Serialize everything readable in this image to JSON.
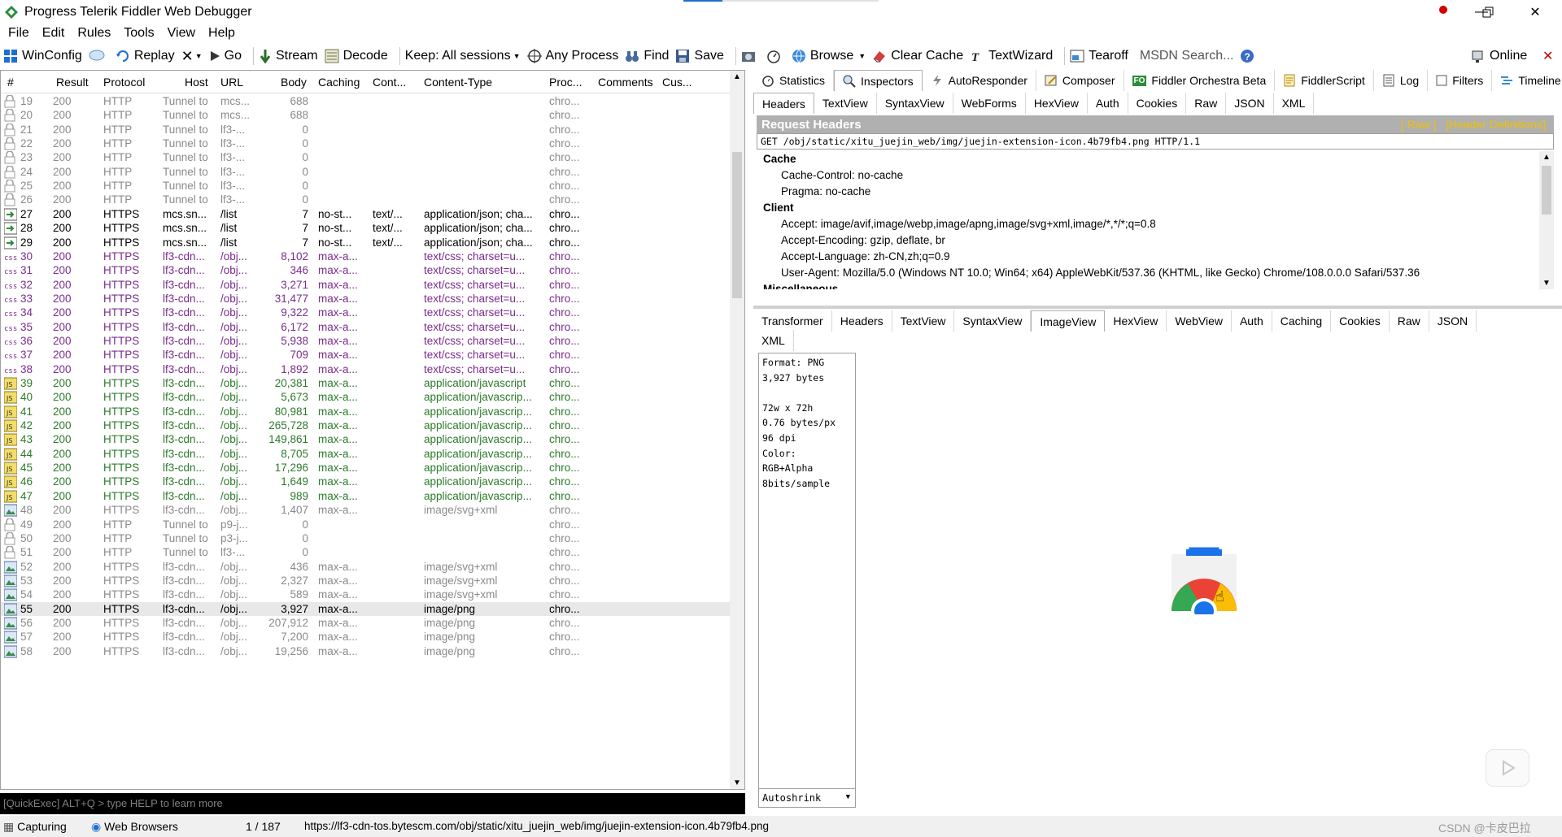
{
  "window": {
    "title": "Progress Telerik Fiddler Web Debugger"
  },
  "menu": [
    "File",
    "Edit",
    "Rules",
    "Tools",
    "View",
    "Help"
  ],
  "toolbar": {
    "winconfig": "WinConfig",
    "replay": "Replay",
    "go": "Go",
    "stream": "Stream",
    "decode": "Decode",
    "keep": "Keep: All sessions",
    "any_process": "Any Process",
    "find": "Find",
    "save": "Save",
    "browse": "Browse",
    "clear_cache": "Clear Cache",
    "textwizard": "TextWizard",
    "tearoff": "Tearoff",
    "msdn_search": "MSDN Search...",
    "online": "Online"
  },
  "columns": [
    "#",
    "Result",
    "Protocol",
    "Host",
    "URL",
    "Body",
    "Caching",
    "Cont...",
    "Content-Type",
    "Proc...",
    "Comments",
    "Cus..."
  ],
  "sessions": [
    {
      "icon": "lock",
      "color": "gray",
      "id": "19",
      "result": "200",
      "protocol": "HTTP",
      "host": "Tunnel to",
      "url": "mcs...",
      "body": "688",
      "caching": "",
      "cont": "",
      "ctype": "",
      "proc": "chro..."
    },
    {
      "icon": "lock",
      "color": "gray",
      "id": "20",
      "result": "200",
      "protocol": "HTTP",
      "host": "Tunnel to",
      "url": "mcs...",
      "body": "688",
      "caching": "",
      "cont": "",
      "ctype": "",
      "proc": "chro..."
    },
    {
      "icon": "lock",
      "color": "gray",
      "id": "21",
      "result": "200",
      "protocol": "HTTP",
      "host": "Tunnel to",
      "url": "lf3-...",
      "body": "0",
      "caching": "",
      "cont": "",
      "ctype": "",
      "proc": "chro..."
    },
    {
      "icon": "lock",
      "color": "gray",
      "id": "22",
      "result": "200",
      "protocol": "HTTP",
      "host": "Tunnel to",
      "url": "lf3-...",
      "body": "0",
      "caching": "",
      "cont": "",
      "ctype": "",
      "proc": "chro..."
    },
    {
      "icon": "lock",
      "color": "gray",
      "id": "23",
      "result": "200",
      "protocol": "HTTP",
      "host": "Tunnel to",
      "url": "lf3-...",
      "body": "0",
      "caching": "",
      "cont": "",
      "ctype": "",
      "proc": "chro..."
    },
    {
      "icon": "lock",
      "color": "gray",
      "id": "24",
      "result": "200",
      "protocol": "HTTP",
      "host": "Tunnel to",
      "url": "lf3-...",
      "body": "0",
      "caching": "",
      "cont": "",
      "ctype": "",
      "proc": "chro..."
    },
    {
      "icon": "lock",
      "color": "gray",
      "id": "25",
      "result": "200",
      "protocol": "HTTP",
      "host": "Tunnel to",
      "url": "lf3-...",
      "body": "0",
      "caching": "",
      "cont": "",
      "ctype": "",
      "proc": "chro..."
    },
    {
      "icon": "lock",
      "color": "gray",
      "id": "26",
      "result": "200",
      "protocol": "HTTP",
      "host": "Tunnel to",
      "url": "lf3-...",
      "body": "0",
      "caching": "",
      "cont": "",
      "ctype": "",
      "proc": "chro..."
    },
    {
      "icon": "json",
      "color": "black",
      "id": "27",
      "result": "200",
      "protocol": "HTTPS",
      "host": "mcs.sn...",
      "url": "/list",
      "body": "7",
      "caching": "no-st...",
      "cont": "text/...",
      "ctype": "application/json; cha...",
      "proc": "chro..."
    },
    {
      "icon": "json",
      "color": "black",
      "id": "28",
      "result": "200",
      "protocol": "HTTPS",
      "host": "mcs.sn...",
      "url": "/list",
      "body": "7",
      "caching": "no-st...",
      "cont": "text/...",
      "ctype": "application/json; cha...",
      "proc": "chro..."
    },
    {
      "icon": "json",
      "color": "black",
      "id": "29",
      "result": "200",
      "protocol": "HTTPS",
      "host": "mcs.sn...",
      "url": "/list",
      "body": "7",
      "caching": "no-st...",
      "cont": "text/...",
      "ctype": "application/json; cha...",
      "proc": "chro..."
    },
    {
      "icon": "css",
      "color": "purple",
      "id": "30",
      "result": "200",
      "protocol": "HTTPS",
      "host": "lf3-cdn...",
      "url": "/obj...",
      "body": "8,102",
      "caching": "max-a...",
      "cont": "",
      "ctype": "text/css; charset=u...",
      "proc": "chro..."
    },
    {
      "icon": "css",
      "color": "purple",
      "id": "31",
      "result": "200",
      "protocol": "HTTPS",
      "host": "lf3-cdn...",
      "url": "/obj...",
      "body": "346",
      "caching": "max-a...",
      "cont": "",
      "ctype": "text/css; charset=u...",
      "proc": "chro..."
    },
    {
      "icon": "css",
      "color": "purple",
      "id": "32",
      "result": "200",
      "protocol": "HTTPS",
      "host": "lf3-cdn...",
      "url": "/obj...",
      "body": "3,271",
      "caching": "max-a...",
      "cont": "",
      "ctype": "text/css; charset=u...",
      "proc": "chro..."
    },
    {
      "icon": "css",
      "color": "purple",
      "id": "33",
      "result": "200",
      "protocol": "HTTPS",
      "host": "lf3-cdn...",
      "url": "/obj...",
      "body": "31,477",
      "caching": "max-a...",
      "cont": "",
      "ctype": "text/css; charset=u...",
      "proc": "chro..."
    },
    {
      "icon": "css",
      "color": "purple",
      "id": "34",
      "result": "200",
      "protocol": "HTTPS",
      "host": "lf3-cdn...",
      "url": "/obj...",
      "body": "9,322",
      "caching": "max-a...",
      "cont": "",
      "ctype": "text/css; charset=u...",
      "proc": "chro..."
    },
    {
      "icon": "css",
      "color": "purple",
      "id": "35",
      "result": "200",
      "protocol": "HTTPS",
      "host": "lf3-cdn...",
      "url": "/obj...",
      "body": "6,172",
      "caching": "max-a...",
      "cont": "",
      "ctype": "text/css; charset=u...",
      "proc": "chro..."
    },
    {
      "icon": "css",
      "color": "purple",
      "id": "36",
      "result": "200",
      "protocol": "HTTPS",
      "host": "lf3-cdn...",
      "url": "/obj...",
      "body": "5,938",
      "caching": "max-a...",
      "cont": "",
      "ctype": "text/css; charset=u...",
      "proc": "chro..."
    },
    {
      "icon": "css",
      "color": "purple",
      "id": "37",
      "result": "200",
      "protocol": "HTTPS",
      "host": "lf3-cdn...",
      "url": "/obj...",
      "body": "709",
      "caching": "max-a...",
      "cont": "",
      "ctype": "text/css; charset=u...",
      "proc": "chro..."
    },
    {
      "icon": "css",
      "color": "purple",
      "id": "38",
      "result": "200",
      "protocol": "HTTPS",
      "host": "lf3-cdn...",
      "url": "/obj...",
      "body": "1,892",
      "caching": "max-a...",
      "cont": "",
      "ctype": "text/css; charset=u...",
      "proc": "chro..."
    },
    {
      "icon": "js",
      "color": "green",
      "id": "39",
      "result": "200",
      "protocol": "HTTPS",
      "host": "lf3-cdn...",
      "url": "/obj...",
      "body": "20,381",
      "caching": "max-a...",
      "cont": "",
      "ctype": "application/javascript",
      "proc": "chro..."
    },
    {
      "icon": "js",
      "color": "green",
      "id": "40",
      "result": "200",
      "protocol": "HTTPS",
      "host": "lf3-cdn...",
      "url": "/obj...",
      "body": "5,673",
      "caching": "max-a...",
      "cont": "",
      "ctype": "application/javascrip...",
      "proc": "chro..."
    },
    {
      "icon": "js",
      "color": "green",
      "id": "41",
      "result": "200",
      "protocol": "HTTPS",
      "host": "lf3-cdn...",
      "url": "/obj...",
      "body": "80,981",
      "caching": "max-a...",
      "cont": "",
      "ctype": "application/javascrip...",
      "proc": "chro..."
    },
    {
      "icon": "js",
      "color": "green",
      "id": "42",
      "result": "200",
      "protocol": "HTTPS",
      "host": "lf3-cdn...",
      "url": "/obj...",
      "body": "265,728",
      "caching": "max-a...",
      "cont": "",
      "ctype": "application/javascrip...",
      "proc": "chro..."
    },
    {
      "icon": "js",
      "color": "green",
      "id": "43",
      "result": "200",
      "protocol": "HTTPS",
      "host": "lf3-cdn...",
      "url": "/obj...",
      "body": "149,861",
      "caching": "max-a...",
      "cont": "",
      "ctype": "application/javascrip...",
      "proc": "chro..."
    },
    {
      "icon": "js",
      "color": "green",
      "id": "44",
      "result": "200",
      "protocol": "HTTPS",
      "host": "lf3-cdn...",
      "url": "/obj...",
      "body": "8,705",
      "caching": "max-a...",
      "cont": "",
      "ctype": "application/javascrip...",
      "proc": "chro..."
    },
    {
      "icon": "js",
      "color": "green",
      "id": "45",
      "result": "200",
      "protocol": "HTTPS",
      "host": "lf3-cdn...",
      "url": "/obj...",
      "body": "17,296",
      "caching": "max-a...",
      "cont": "",
      "ctype": "application/javascrip...",
      "proc": "chro..."
    },
    {
      "icon": "js",
      "color": "green",
      "id": "46",
      "result": "200",
      "protocol": "HTTPS",
      "host": "lf3-cdn...",
      "url": "/obj...",
      "body": "1,649",
      "caching": "max-a...",
      "cont": "",
      "ctype": "application/javascrip...",
      "proc": "chro..."
    },
    {
      "icon": "js",
      "color": "green",
      "id": "47",
      "result": "200",
      "protocol": "HTTPS",
      "host": "lf3-cdn...",
      "url": "/obj...",
      "body": "989",
      "caching": "max-a...",
      "cont": "",
      "ctype": "application/javascrip...",
      "proc": "chro..."
    },
    {
      "icon": "image",
      "color": "gray",
      "id": "48",
      "result": "200",
      "protocol": "HTTPS",
      "host": "lf3-cdn...",
      "url": "/obj...",
      "body": "1,407",
      "caching": "max-a...",
      "cont": "",
      "ctype": "image/svg+xml",
      "proc": "chro..."
    },
    {
      "icon": "lock",
      "color": "gray",
      "id": "49",
      "result": "200",
      "protocol": "HTTP",
      "host": "Tunnel to",
      "url": "p9-j...",
      "body": "0",
      "caching": "",
      "cont": "",
      "ctype": "",
      "proc": "chro..."
    },
    {
      "icon": "lock",
      "color": "gray",
      "id": "50",
      "result": "200",
      "protocol": "HTTP",
      "host": "Tunnel to",
      "url": "p3-j...",
      "body": "0",
      "caching": "",
      "cont": "",
      "ctype": "",
      "proc": "chro..."
    },
    {
      "icon": "lock",
      "color": "gray",
      "id": "51",
      "result": "200",
      "protocol": "HTTP",
      "host": "Tunnel to",
      "url": "lf3-...",
      "body": "0",
      "caching": "",
      "cont": "",
      "ctype": "",
      "proc": "chro..."
    },
    {
      "icon": "image",
      "color": "gray",
      "id": "52",
      "result": "200",
      "protocol": "HTTPS",
      "host": "lf3-cdn...",
      "url": "/obj...",
      "body": "436",
      "caching": "max-a...",
      "cont": "",
      "ctype": "image/svg+xml",
      "proc": "chro..."
    },
    {
      "icon": "image",
      "color": "gray",
      "id": "53",
      "result": "200",
      "protocol": "HTTPS",
      "host": "lf3-cdn...",
      "url": "/obj...",
      "body": "2,327",
      "caching": "max-a...",
      "cont": "",
      "ctype": "image/svg+xml",
      "proc": "chro..."
    },
    {
      "icon": "image",
      "color": "gray",
      "id": "54",
      "result": "200",
      "protocol": "HTTPS",
      "host": "lf3-cdn...",
      "url": "/obj...",
      "body": "589",
      "caching": "max-a...",
      "cont": "",
      "ctype": "image/svg+xml",
      "proc": "chro..."
    },
    {
      "icon": "image",
      "color": "black",
      "id": "55",
      "result": "200",
      "protocol": "HTTPS",
      "host": "lf3-cdn...",
      "url": "/obj...",
      "body": "3,927",
      "caching": "max-a...",
      "cont": "",
      "ctype": "image/png",
      "proc": "chro...",
      "selected": true
    },
    {
      "icon": "image",
      "color": "gray",
      "id": "56",
      "result": "200",
      "protocol": "HTTPS",
      "host": "lf3-cdn...",
      "url": "/obj...",
      "body": "207,912",
      "caching": "max-a...",
      "cont": "",
      "ctype": "image/png",
      "proc": "chro..."
    },
    {
      "icon": "image",
      "color": "gray",
      "id": "57",
      "result": "200",
      "protocol": "HTTPS",
      "host": "lf3-cdn...",
      "url": "/obj...",
      "body": "7,200",
      "caching": "max-a...",
      "cont": "",
      "ctype": "image/png",
      "proc": "chro..."
    },
    {
      "icon": "image",
      "color": "gray",
      "id": "58",
      "result": "200",
      "protocol": "HTTPS",
      "host": "lf3-cdn...",
      "url": "/obj...",
      "body": "19,256",
      "caching": "max-a...",
      "cont": "",
      "ctype": "image/png",
      "proc": "chro..."
    }
  ],
  "quickexec": "[QuickExec] ALT+Q > type HELP to learn more",
  "top_tabs": [
    "Statistics",
    "Inspectors",
    "AutoResponder",
    "Composer",
    "Fiddler Orchestra Beta",
    "FiddlerScript",
    "Log",
    "Filters",
    "Timeline"
  ],
  "request_tabs": [
    "Headers",
    "TextView",
    "SyntaxView",
    "WebForms",
    "HexView",
    "Auth",
    "Cookies",
    "Raw",
    "JSON",
    "XML"
  ],
  "request_headers": {
    "title": "Request Headers",
    "raw_link": "[ Raw ]",
    "defs_link": "[Header Definitions]",
    "request_line": "GET /obj/static/xitu_juejin_web/img/juejin-extension-icon.4b79fb4.png HTTP/1.1",
    "groups": [
      {
        "name": "Cache",
        "items": [
          "Cache-Control: no-cache",
          "Pragma: no-cache"
        ]
      },
      {
        "name": "Client",
        "items": [
          "Accept: image/avif,image/webp,image/apng,image/svg+xml,image/*,*/*;q=0.8",
          "Accept-Encoding: gzip, deflate, br",
          "Accept-Language: zh-CN,zh;q=0.9",
          "User-Agent: Mozilla/5.0 (Windows NT 10.0; Win64; x64) AppleWebKit/537.36 (KHTML, like Gecko) Chrome/108.0.0.0 Safari/537.36"
        ]
      },
      {
        "name": "Miscellaneous",
        "items": []
      }
    ]
  },
  "response_tabs": [
    "Transformer",
    "Headers",
    "TextView",
    "SyntaxView",
    "ImageView",
    "HexView",
    "WebView",
    "Auth",
    "Caching",
    "Cookies",
    "Raw",
    "JSON"
  ],
  "response_tabs_row2": [
    "XML"
  ],
  "image_info": [
    "Format: PNG",
    "3,927 bytes",
    "",
    "72w x 72h",
    "0.76 bytes/px",
    "96 dpi",
    "Color:",
    "RGB+Alpha",
    "8bits/sample"
  ],
  "autoshrink": "Autoshrink",
  "status": {
    "capturing": "Capturing",
    "browsers": "Web Browsers",
    "count": "1 / 187",
    "url": "https://lf3-cdn-tos.bytescm.com/obj/static/xitu_juejin_web/img/juejin-extension-icon.4b79fb4.png"
  },
  "watermark": "CSDN @卡皮巴拉",
  "colors": {
    "accent": "#1e6fcf",
    "purple": "#7a2c8c",
    "green": "#2c7a2c",
    "gray": "#8a8a8a",
    "header_bar": "#b0b0b0",
    "link": "#f0c000"
  }
}
